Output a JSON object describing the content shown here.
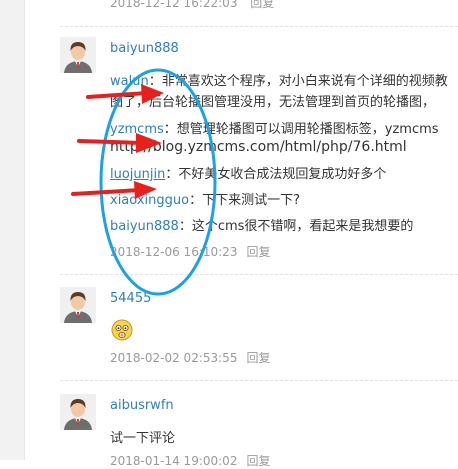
{
  "previous": {
    "date": "2018-12-12 16:22:03",
    "reply_label": "回复"
  },
  "comments": [
    {
      "username": "baiyun888",
      "replies": [
        {
          "who": "walun",
          "sep": "：",
          "text": "非常喜欢这个程序，对小白来说有个详细的视频教"
        },
        {
          "text": "图了，后台轮播图管理没用，无法管理到首页的轮播图，"
        },
        {
          "who": "yzmcms",
          "sep": "：",
          "text": "想管理轮播图可以调用轮播图标签，yzmcms"
        },
        {
          "text": "http://blog.yzmcms.com/html/php/76.html"
        },
        {
          "who": "luojunjin",
          "sep": "：",
          "text": "不好美女收合成法规回复成功好多个"
        },
        {
          "who": "xiaoxingguo",
          "sep": "：",
          "text": "下下来测试一下?"
        },
        {
          "who": "baiyun888",
          "sep": "：",
          "text": "这个cms很不错啊，看起来是我想要的"
        }
      ],
      "date": "2018-12-06 16:10:23",
      "reply_label": "回复"
    },
    {
      "username": "54455",
      "text": "",
      "date": "2018-02-02 02:53:55",
      "reply_label": "回复"
    },
    {
      "username": "aibusrwfn",
      "text": "试一下评论",
      "date": "2018-01-14 19:00:02",
      "reply_label": "回复"
    }
  ],
  "annotation": {
    "arrow_color": "#e8201d",
    "circle_color": "#1aa1e6"
  }
}
